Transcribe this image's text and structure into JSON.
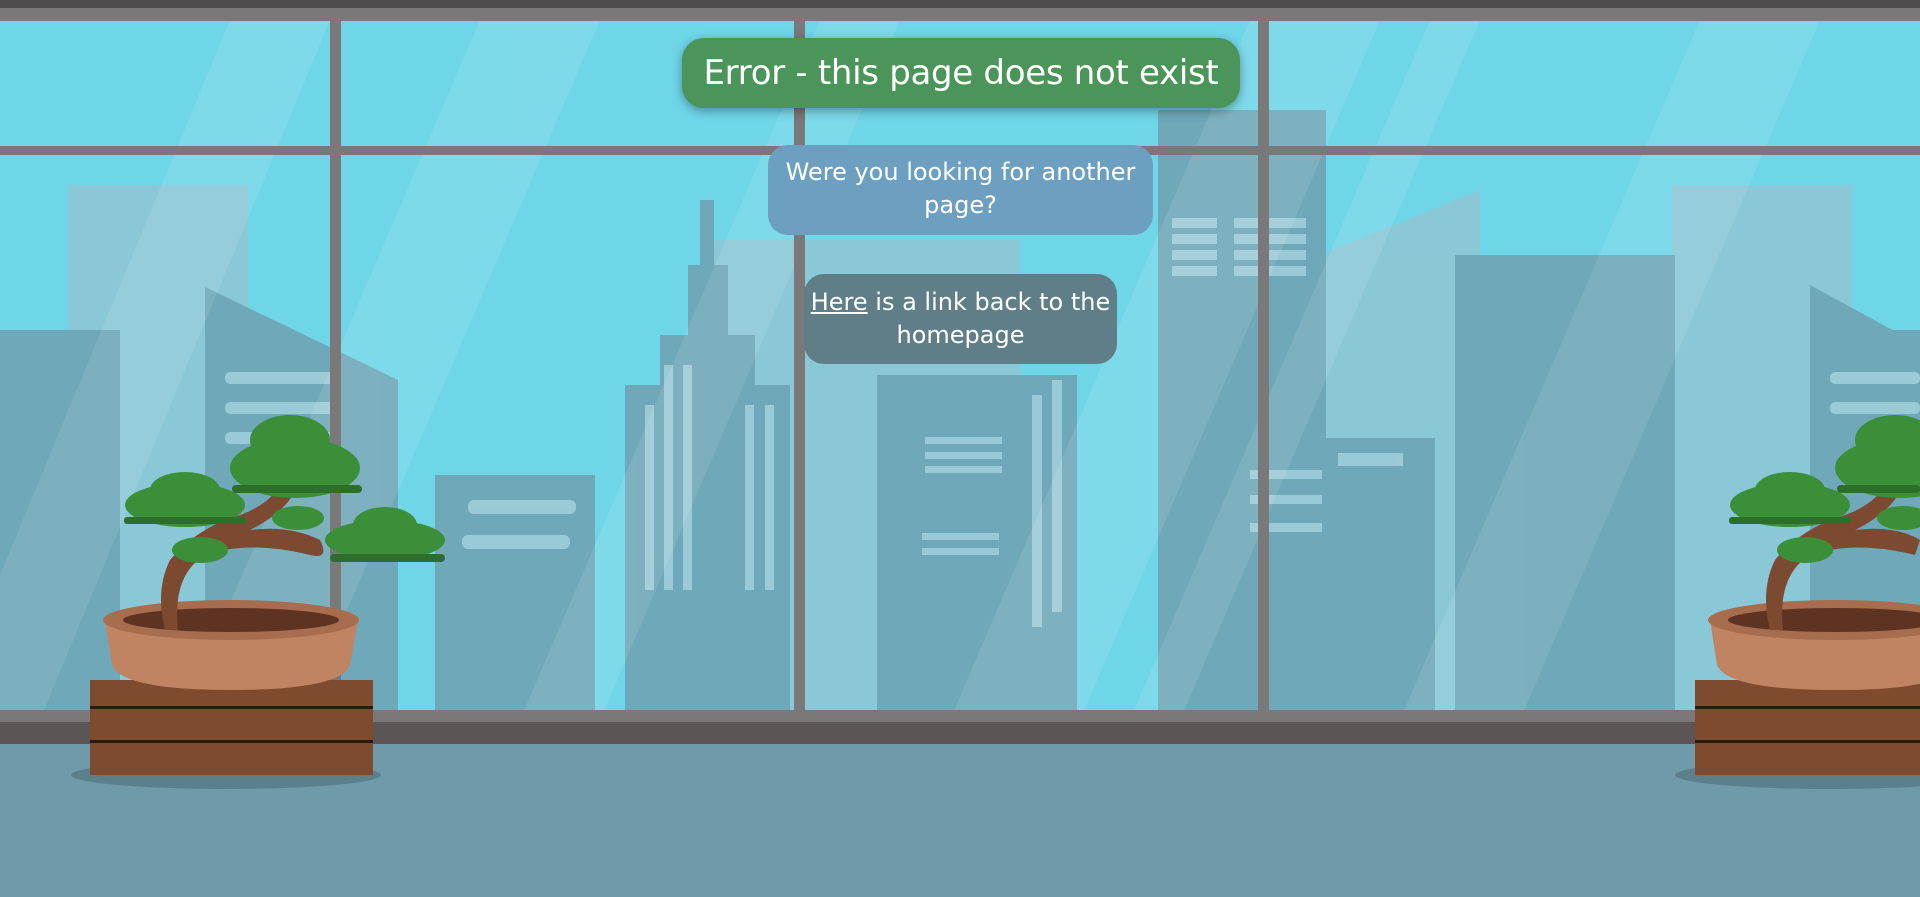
{
  "error": {
    "title": "Error - this page does not exist"
  },
  "question": {
    "text": "Were you looking for another page?"
  },
  "home_link": {
    "link_text": "Here",
    "suffix_text": " is a link back to the homepage"
  },
  "colors": {
    "sky": "#70d7e9",
    "title_bubble": "#4c955a",
    "question_bubble": "#6d9fc0",
    "link_bubble": "#5f7e88",
    "window_frame": "#7b7879",
    "floor": "#6f9aaa",
    "crate": "#7f4b2e",
    "pot": "#c08463",
    "foliage": "#3b8f38",
    "trunk": "#7b4a31"
  },
  "illustration": {
    "plant_left": "bonsai-plant",
    "plant_right": "bonsai-plant",
    "background": "city-skyline-through-window"
  }
}
